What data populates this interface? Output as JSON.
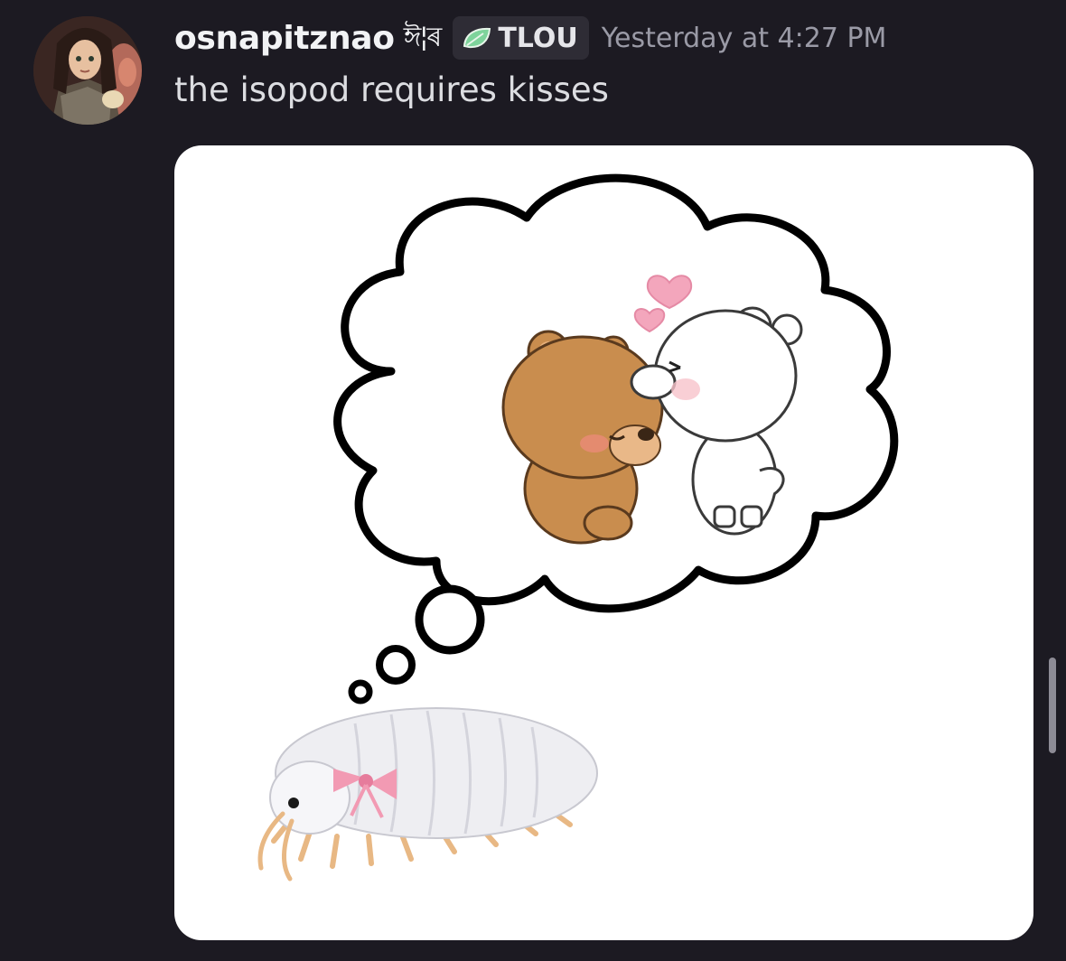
{
  "message": {
    "username": "osnapitznao",
    "name_decoration": "ঈ¦ৰ",
    "tag": {
      "icon": "leaf-icon",
      "label": "TLOU",
      "color": "#7ed39b"
    },
    "timestamp": "Yesterday at 4:27 PM",
    "text": "the isopod requires kisses"
  },
  "attachment": {
    "type": "image",
    "subject": "meme-isopod-thought-bubble-kissing-bears"
  },
  "colors": {
    "background": "#1c1a22",
    "username": "#f2f3f5",
    "timestamp": "#9a9aa6",
    "message_text": "#dcdde1",
    "tag_background": "#2e2c35"
  }
}
